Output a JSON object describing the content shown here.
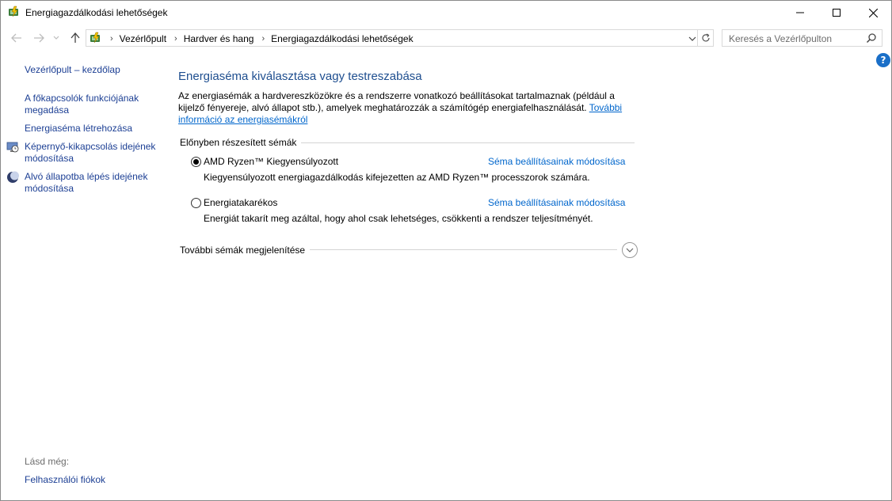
{
  "window": {
    "title": "Energiagazdálkodási lehetőségek"
  },
  "address": {
    "crumbs": [
      "Vezérlőpult",
      "Hardver és hang",
      "Energiagazdálkodási lehetőségek"
    ]
  },
  "search": {
    "placeholder": "Keresés a Vezérlőpulton"
  },
  "help": {
    "label": "?"
  },
  "sidebar": {
    "items": [
      {
        "label": "Vezérlőpult – kezdőlap"
      },
      {
        "label": "A főkapcsolók funkciójának megadása"
      },
      {
        "label": "Energiaséma létrehozása"
      },
      {
        "label": "Képernyő-kikapcsolás idejének módosítása"
      },
      {
        "label": "Alvó állapotba lépés idejének módosítása"
      }
    ],
    "see_also": "Lásd még:",
    "see_also_links": [
      {
        "label": "Felhasználói fiókok"
      }
    ]
  },
  "main": {
    "heading": "Energiaséma kiválasztása vagy testreszabása",
    "description": "Az energiasémák a hardvereszközökre és a rendszerre vonatkozó beállításokat tartalmaznak (például a kijelző fényereje, alvó állapot stb.), amelyek meghatározzák a számítógép energiafelhasználását. ",
    "description_link": "További információ az energiasémákról",
    "preferred_title": "Előnyben részesített sémák",
    "plans": [
      {
        "name": "AMD Ryzen™ Kiegyensúlyozott",
        "selected": true,
        "link": "Séma beállításainak módosítása",
        "desc": "Kiegyensúlyozott energiagazdálkodás kifejezetten az AMD Ryzen™ processzorok számára."
      },
      {
        "name": "Energiatakarékos",
        "selected": false,
        "link": "Séma beállításainak módosítása",
        "desc": "Energiát takarít meg azáltal, hogy ahol csak lehetséges, csökkenti a rendszer teljesítményét."
      }
    ],
    "more_plans": "További sémák megjelenítése"
  },
  "colors": {
    "link": "#1c3f94",
    "heading": "#1e4e8f",
    "accent": "#0066cc",
    "help": "#1a6fc8"
  }
}
